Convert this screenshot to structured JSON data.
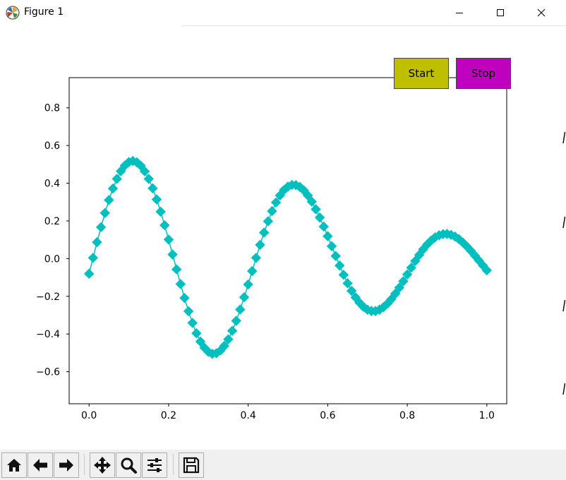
{
  "window": {
    "title": "Figure 1",
    "icon": "matplotlib-icon",
    "controls": [
      "minimize-icon",
      "maximize-icon",
      "close-icon"
    ]
  },
  "buttons": {
    "start": {
      "label": "Start",
      "color": "#bfbf00"
    },
    "stop": {
      "label": "Stop",
      "color": "#bf00bf"
    }
  },
  "toolbar": {
    "tools": [
      "home-icon",
      "back-icon",
      "forward-icon",
      "pan-icon",
      "zoom-icon",
      "configure-subplots-icon",
      "save-icon"
    ]
  },
  "chart_data": {
    "type": "line",
    "title": "",
    "xlabel": "",
    "ylabel": "",
    "xlim": [
      -0.05,
      1.05
    ],
    "ylim": [
      -0.77,
      0.96
    ],
    "xticks": [
      0.0,
      0.2,
      0.4,
      0.6,
      0.8,
      1.0
    ],
    "xtick_labels": [
      "0.0",
      "0.2",
      "0.4",
      "0.6",
      "0.8",
      "1.0"
    ],
    "yticks": [
      -0.6,
      -0.4,
      -0.2,
      0.0,
      0.2,
      0.4,
      0.6,
      0.8
    ],
    "ytick_labels": [
      "−0.6",
      "−0.4",
      "−0.2",
      "0.0",
      "0.2",
      "0.4",
      "0.6",
      "0.8"
    ],
    "grid": false,
    "marker": "diamond",
    "color": "#00bfbf",
    "series": [
      {
        "x": [
          0.0,
          0.01,
          0.02,
          0.03,
          0.04,
          0.05,
          0.06,
          0.07,
          0.08,
          0.09,
          0.1,
          0.11,
          0.12,
          0.13,
          0.14,
          0.15,
          0.16,
          0.17,
          0.18,
          0.19,
          0.2,
          0.21,
          0.22,
          0.23,
          0.24,
          0.25,
          0.26,
          0.27,
          0.28,
          0.29,
          0.3,
          0.31,
          0.32,
          0.33,
          0.34,
          0.35,
          0.36,
          0.37,
          0.38,
          0.39,
          0.4,
          0.41,
          0.42,
          0.43,
          0.44,
          0.45,
          0.46,
          0.47,
          0.48,
          0.49,
          0.5,
          0.51,
          0.52,
          0.53,
          0.54,
          0.55,
          0.56,
          0.57,
          0.58,
          0.59,
          0.6,
          0.61,
          0.62,
          0.63,
          0.64,
          0.65,
          0.66,
          0.67,
          0.68,
          0.69,
          0.7,
          0.71,
          0.72,
          0.73,
          0.74,
          0.75,
          0.76,
          0.77,
          0.78,
          0.79,
          0.8,
          0.81,
          0.82,
          0.83,
          0.84,
          0.85,
          0.86,
          0.87,
          0.88,
          0.89,
          0.9,
          0.91,
          0.92,
          0.93,
          0.94,
          0.95,
          0.96,
          0.97,
          0.98,
          0.99,
          1.0
        ],
        "y": [
          -0.08,
          0.004,
          0.087,
          0.167,
          0.242,
          0.311,
          0.372,
          0.423,
          0.464,
          0.494,
          0.512,
          0.518,
          0.511,
          0.493,
          0.463,
          0.423,
          0.373,
          0.314,
          0.249,
          0.177,
          0.101,
          0.022,
          -0.057,
          -0.135,
          -0.209,
          -0.279,
          -0.341,
          -0.396,
          -0.44,
          -0.473,
          -0.495,
          -0.505,
          -0.502,
          -0.488,
          -0.463,
          -0.428,
          -0.383,
          -0.33,
          -0.27,
          -0.205,
          -0.137,
          -0.066,
          0.004,
          0.073,
          0.138,
          0.198,
          0.252,
          0.298,
          0.335,
          0.364,
          0.382,
          0.391,
          0.39,
          0.38,
          0.362,
          0.335,
          0.302,
          0.262,
          0.218,
          0.17,
          0.119,
          0.066,
          0.014,
          -0.037,
          -0.086,
          -0.131,
          -0.171,
          -0.206,
          -0.234,
          -0.256,
          -0.271,
          -0.278,
          -0.278,
          -0.271,
          -0.258,
          -0.239,
          -0.215,
          -0.186,
          -0.154,
          -0.12,
          -0.084,
          -0.048,
          -0.013,
          0.019,
          0.049,
          0.075,
          0.096,
          0.113,
          0.124,
          0.13,
          0.131,
          0.126,
          0.117,
          0.103,
          0.085,
          0.064,
          0.041,
          0.016,
          -0.01,
          -0.036,
          -0.062
        ]
      }
    ]
  }
}
